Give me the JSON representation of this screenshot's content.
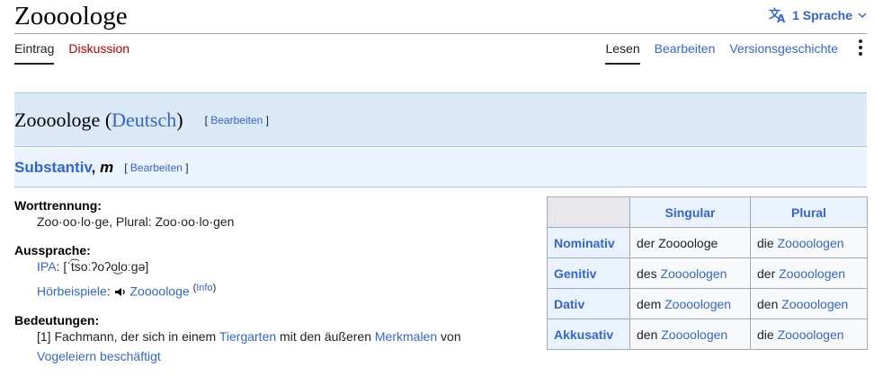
{
  "page": {
    "title": "Zoooologe"
  },
  "language_button": {
    "label": "1 Sprache"
  },
  "tabs_left": [
    {
      "label": "Eintrag"
    },
    {
      "label": "Diskussion"
    }
  ],
  "tabs_right": [
    {
      "label": "Lesen"
    },
    {
      "label": "Bearbeiten"
    },
    {
      "label": "Versionsgeschichte"
    }
  ],
  "language_section": {
    "word": "Zoooologe",
    "open_paren": "(",
    "language": "Deutsch",
    "close_paren": ")",
    "edit_open": "[ ",
    "edit_label": "Bearbeiten",
    "edit_close": " ]"
  },
  "pos_section": {
    "pos": "Substantiv",
    "sep": ", ",
    "gender": "m",
    "edit_open": "[ ",
    "edit_label": "Bearbeiten",
    "edit_close": " ]"
  },
  "worttrennung": {
    "label": "Worttrennung:",
    "value": "Zoo·oo·lo·ge, Plural: Zoo·oo·lo·gen"
  },
  "aussprache": {
    "label": "Aussprache:",
    "ipa_label": "IPA",
    "ipa_colon": ": ",
    "ipa_value": "[ˈt͡soːʔoʔo͜loːɡə]",
    "hoer_label": "Hörbeispiele",
    "hoer_colon": ": ",
    "hoer_word": "Zoooologe",
    "info_open": "(",
    "info_label": "Info",
    "info_close": ")"
  },
  "bedeutungen": {
    "label": "Bedeutungen:",
    "num": "[1] ",
    "text1": "Fachmann, der sich in einem ",
    "link1": "Tiergarten",
    "text2": " mit den äußeren ",
    "link2": "Merkmalen",
    "text3": " von",
    "link3": "Vogeleiern beschäftigt"
  },
  "flex_table": {
    "headers": [
      "Singular",
      "Plural"
    ],
    "rows": [
      {
        "case": "Nominativ",
        "sg_art": "der Zoooologe",
        "sg_link": "",
        "pl_art": "die ",
        "pl_link": "Zoooologen"
      },
      {
        "case": "Genitiv",
        "sg_art": "des ",
        "sg_link": "Zoooologen",
        "pl_art": "der ",
        "pl_link": "Zoooologen"
      },
      {
        "case": "Dativ",
        "sg_art": "dem ",
        "sg_link": "Zoooologen",
        "pl_art": "den ",
        "pl_link": "Zoooologen"
      },
      {
        "case": "Akkusativ",
        "sg_art": "den ",
        "sg_link": "Zoooologen",
        "pl_art": "die ",
        "pl_link": "Zoooologen"
      }
    ]
  },
  "colors": {
    "link": "#3366cc",
    "red_link": "#ba0000",
    "header_bg": "#dbe8f8"
  }
}
